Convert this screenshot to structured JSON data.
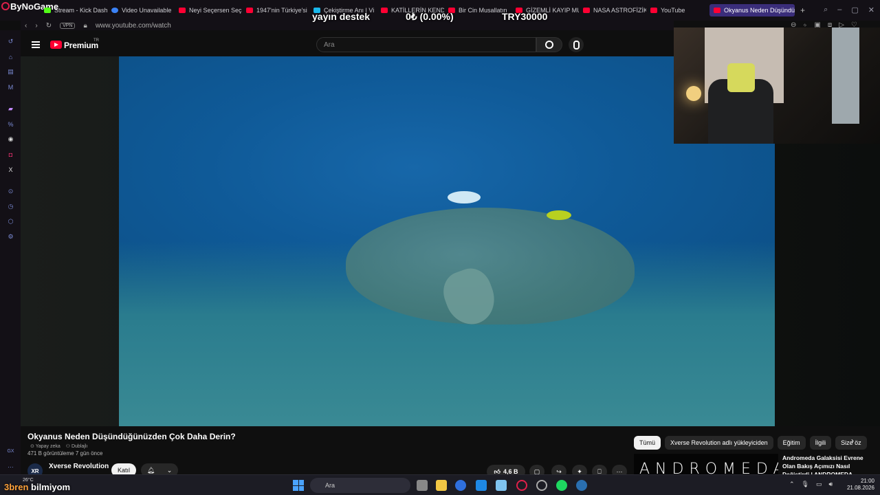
{
  "browser": {
    "brand": "ByNoGame",
    "tabs": [
      {
        "label": "Stream - Kick Dash",
        "icon": "kick-icon"
      },
      {
        "label": "Video Unavailable",
        "icon": "video-icon"
      },
      {
        "label": "Neyi Seçersen Seç",
        "icon": "youtube-icon"
      },
      {
        "label": "1947'nin Türkiye'si",
        "icon": "youtube-icon"
      },
      {
        "label": "Çekiştirme Anı | Vi",
        "icon": "vimeo-icon"
      },
      {
        "label": "KATİLLERİN KENDİ",
        "icon": "youtube-icon"
      },
      {
        "label": "Bir Cin Musallatın",
        "icon": "youtube-icon"
      },
      {
        "label": "GİZEMLİ KAYIP MU",
        "icon": "youtube-icon"
      },
      {
        "label": "NASA ASTROFİZİK",
        "icon": "youtube-icon"
      },
      {
        "label": "YouTube",
        "icon": "youtube-icon"
      }
    ],
    "active_tab": "Okyanus Neden Düşündüğ",
    "url": "www.youtube.com/watch",
    "vpn_label": "VPN"
  },
  "stream_overlay": {
    "label": "yayın destek",
    "progress": "0₺ (0.00%)",
    "goal": "TRY30000"
  },
  "youtube": {
    "logo_text": "Premium",
    "region": "TR",
    "search_placeholder": "Ara",
    "video_title": "Okyanus Neden Düşündüğünüzden Çok Daha Derin?",
    "ai_label": "Yapay zeka",
    "dubbed_label": "Dublajlı",
    "views_line": "471 B görüntüleme  7 gün önce",
    "channel_name": "Xverse Revolution",
    "channel_initials": "XR",
    "join_label": "Katıl",
    "like_count": "4,6 B",
    "chips": [
      "Tümü",
      "Xverse Revolution adlı yükleyiciden",
      "Eğitim",
      "İlgili",
      "Size öz"
    ],
    "rec_thumb_text": "ANDROMEDA",
    "rec_title": "Andromeda Galaksisi Evrene Olan Bakış Açımızı Nasıl Değiştirdi | ANDROMEDA"
  },
  "taskbar": {
    "weather": "26°C",
    "overlay_name_prefix": "3bren",
    "overlay_name": "bilmiyom",
    "search_label": "Ara",
    "time": "21:00",
    "date": "21.08.2026"
  },
  "colors": {
    "youtube_red": "#ff0033",
    "active_tab": "#3a2d7a",
    "opera_sidebar": "#7b8bd6"
  }
}
